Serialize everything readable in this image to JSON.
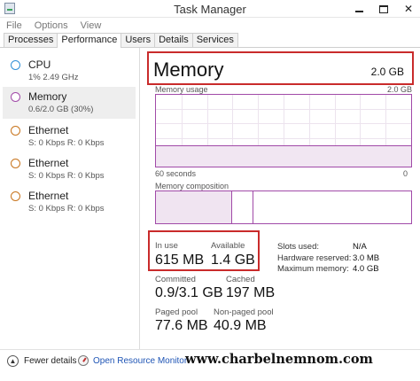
{
  "window": {
    "title": "Task Manager"
  },
  "menu": [
    "File",
    "Options",
    "View"
  ],
  "tabs": [
    "Processes",
    "Performance",
    "Users",
    "Details",
    "Services"
  ],
  "sidebar": {
    "items": [
      {
        "name": "CPU",
        "sub": "1%  2.49 GHz",
        "color": "#2f8fd6"
      },
      {
        "name": "Memory",
        "sub": "0.6/2.0 GB (30%)",
        "color": "#a14aa8"
      },
      {
        "name": "Ethernet",
        "sub": "S: 0 Kbps  R: 0 Kbps",
        "color": "#c8741c"
      },
      {
        "name": "Ethernet",
        "sub": "S: 0 Kbps  R: 0 Kbps",
        "color": "#c8741c"
      },
      {
        "name": "Ethernet",
        "sub": "S: 0 Kbps  R: 0 Kbps",
        "color": "#c8741c"
      }
    ]
  },
  "main": {
    "title": "Memory",
    "total": "2.0 GB",
    "usage_label": "Memory usage",
    "usage_max": "2.0 GB",
    "usage_fraction": 0.3,
    "time_label": "60 seconds",
    "time_end": "0",
    "composition_label": "Memory composition",
    "composition_in_use_fraction": 0.3,
    "composition_modified_fraction": 0.38,
    "stats": {
      "in_use_label": "In use",
      "in_use": "615 MB",
      "available_label": "Available",
      "available": "1.4 GB",
      "committed_label": "Committed",
      "committed": "0.9/3.1 GB",
      "cached_label": "Cached",
      "cached": "197 MB",
      "paged_label": "Paged pool",
      "paged": "77.6 MB",
      "nonpaged_label": "Non-paged pool",
      "nonpaged": "40.9 MB"
    },
    "details": {
      "slots_label": "Slots used:",
      "slots": "N/A",
      "hw_label": "Hardware reserved:",
      "hw": "3.0 MB",
      "max_label": "Maximum memory:",
      "max": "4.0 GB"
    }
  },
  "footer": {
    "fewer_details": "Fewer details",
    "open_resmon": "Open Resource Monitor",
    "watermark": "www.charbelnemnom.com"
  },
  "colors": {
    "accent": "#a14aa8",
    "highlight": "#c92b2b",
    "link": "#1f55b5"
  }
}
